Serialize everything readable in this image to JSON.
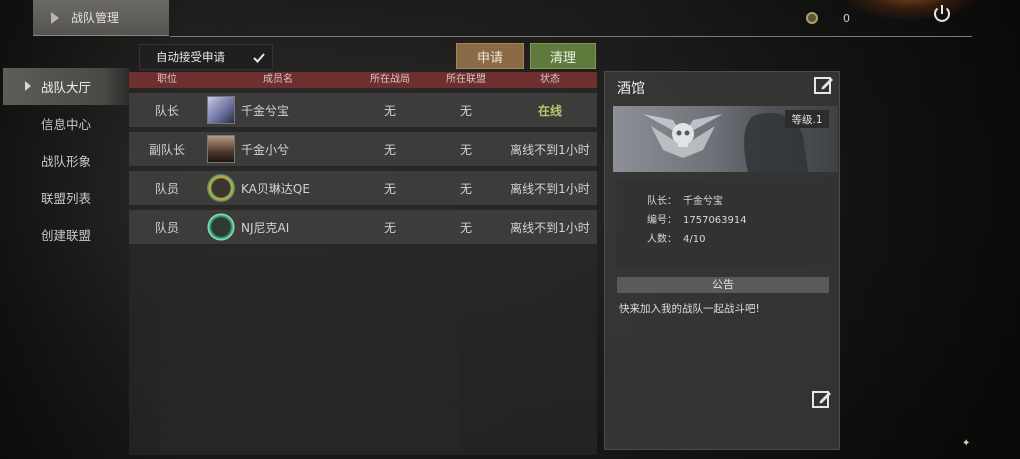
{
  "header": {
    "title": "战队管理",
    "coin_count": "0"
  },
  "nav": {
    "items": [
      {
        "label": "战队大厅",
        "active": true
      },
      {
        "label": "信息中心",
        "active": false
      },
      {
        "label": "战队形象",
        "active": false
      },
      {
        "label": "联盟列表",
        "active": false
      },
      {
        "label": "创建联盟",
        "active": false
      }
    ]
  },
  "controls": {
    "auto_accept_label": "自动接受申请",
    "auto_accept_checked": true,
    "apply_label": "申请",
    "clean_label": "清理"
  },
  "table": {
    "headers": [
      "职位",
      "成员名",
      "所在战局",
      "所在联盟",
      "状态"
    ],
    "rows": [
      {
        "position": "队长",
        "name": "千金兮宝",
        "battle": "无",
        "alliance": "无",
        "status": "在线"
      },
      {
        "position": "副队长",
        "name": "千金小兮",
        "battle": "无",
        "alliance": "无",
        "status": "离线不到1小时"
      },
      {
        "position": "队员",
        "name": "KA贝琳达QE",
        "battle": "无",
        "alliance": "无",
        "status": "离线不到1小时"
      },
      {
        "position": "队员",
        "name": "NJ尼克AI",
        "battle": "无",
        "alliance": "无",
        "status": "离线不到1小时"
      }
    ]
  },
  "panel": {
    "title": "酒馆",
    "level": "等级.1",
    "leader_label": "队长：",
    "leader_value": "千金兮宝",
    "id_label": "编号：",
    "id_value": "1757063914",
    "count_label": "人数：",
    "count_value": "4/10",
    "notice_header": "公告",
    "notice_text": "快来加入我的战队一起战斗吧!"
  },
  "colors": {
    "apply_button": "#8a6b45",
    "clean_button": "#5f7a3c",
    "table_header": "#6e2f2f",
    "online_status": "#b9c66b"
  }
}
